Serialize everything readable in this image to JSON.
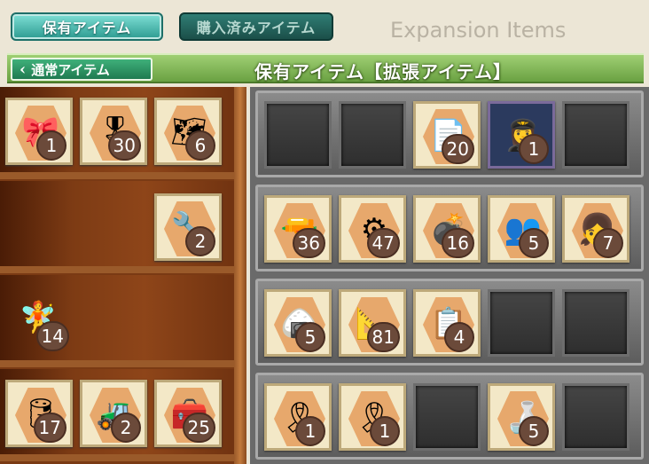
{
  "tabs": {
    "owned": "保有アイテム",
    "purchased": "購入済みアイテム"
  },
  "expansion_title": "Expansion Items",
  "header": {
    "back_label": "通常アイテム",
    "title": "保有アイテム【拡張アイテム】"
  },
  "shelf_items": [
    {
      "icon": "ribbon-icon",
      "glyph": "🎀",
      "count": "1"
    },
    {
      "icon": "medal-icon",
      "glyph": "🎖",
      "count": "30"
    },
    {
      "icon": "map-doc-icon",
      "glyph": "🗺",
      "count": "6"
    },
    {
      "icon": "repair-girl-icon",
      "glyph": "🔧",
      "count": "2"
    },
    {
      "icon": "fairy-icon",
      "glyph": "🧚",
      "count": "14"
    },
    {
      "icon": "drum-can-icon",
      "glyph": "🛢",
      "count": "17"
    },
    {
      "icon": "bulldozer-icon",
      "glyph": "🚜",
      "count": "2"
    },
    {
      "icon": "drum-canister-icon",
      "glyph": "🧰",
      "count": "25"
    }
  ],
  "storage_items": [
    {
      "icon": "documents-icon",
      "glyph": "📄",
      "count": "20"
    },
    {
      "icon": "pilot-icon",
      "glyph": "👩‍✈️",
      "count": "1"
    },
    {
      "icon": "turret-icon",
      "glyph": "🔫",
      "count": "36"
    },
    {
      "icon": "gun-mount-icon",
      "glyph": "⚙",
      "count": "47"
    },
    {
      "icon": "mortar-icon",
      "glyph": "💣",
      "count": "16"
    },
    {
      "icon": "crew-icon",
      "glyph": "👥",
      "count": "5"
    },
    {
      "icon": "akashi-icon",
      "glyph": "👧",
      "count": "7"
    },
    {
      "icon": "rice-ball-icon",
      "glyph": "🍙",
      "count": "5"
    },
    {
      "icon": "blueprints-icon",
      "glyph": "📐",
      "count": "81"
    },
    {
      "icon": "report-icon",
      "glyph": "📋",
      "count": "4"
    },
    {
      "icon": "blue-ribbon-icon",
      "glyph": "🎗",
      "count": "1"
    },
    {
      "icon": "red-ribbon-icon",
      "glyph": "🎗",
      "count": "1"
    },
    {
      "icon": "sake-set-icon",
      "glyph": "🍶",
      "count": "5"
    }
  ],
  "colors": {
    "accent_teal": "#2c9a90",
    "header_green": "#6aa142",
    "count_badge": "#6b4a3a"
  }
}
